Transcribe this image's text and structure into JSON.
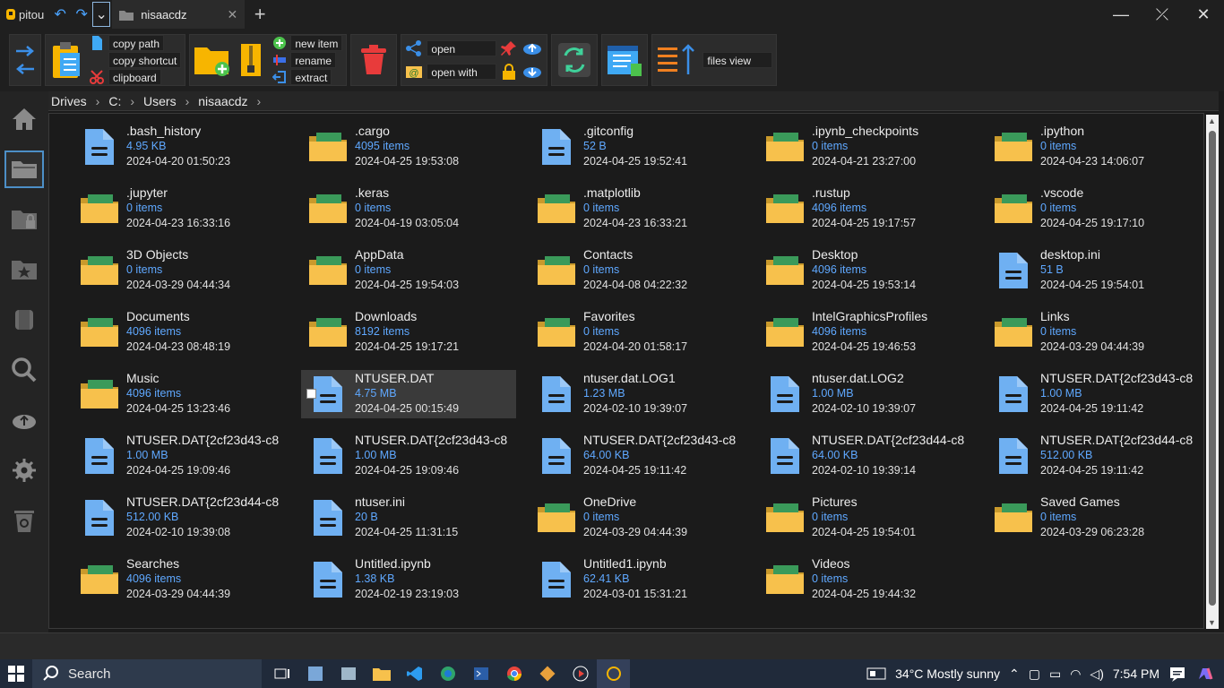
{
  "app": {
    "name": "pitou",
    "tab_title": "nisaacdz"
  },
  "toolbar": {
    "copy_path": "copy path",
    "copy_shortcut": "copy shortcut",
    "clipboard": "clipboard",
    "new_item": "new item",
    "rename": "rename",
    "extract": "extract",
    "open": "open",
    "open_with": "open with",
    "files_view": "files view"
  },
  "breadcrumb": [
    "Drives",
    "C:",
    "Users",
    "nisaacdz"
  ],
  "items": [
    {
      "name": ".bash_history",
      "size": "4.95 KB",
      "date": "2024-04-20 01:50:23",
      "type": "file"
    },
    {
      "name": ".cargo",
      "size": "4095 items",
      "date": "2024-04-25 19:53:08",
      "type": "folder"
    },
    {
      "name": ".gitconfig",
      "size": "52 B",
      "date": "2024-04-25 19:52:41",
      "type": "file"
    },
    {
      "name": ".ipynb_checkpoints",
      "size": "0 items",
      "date": "2024-04-21 23:27:00",
      "type": "folder"
    },
    {
      "name": ".ipython",
      "size": "0 items",
      "date": "2024-04-23 14:06:07",
      "type": "folder"
    },
    {
      "name": ".jupyter",
      "size": "0 items",
      "date": "2024-04-23 16:33:16",
      "type": "folder"
    },
    {
      "name": ".keras",
      "size": "0 items",
      "date": "2024-04-19 03:05:04",
      "type": "folder"
    },
    {
      "name": ".matplotlib",
      "size": "0 items",
      "date": "2024-04-23 16:33:21",
      "type": "folder"
    },
    {
      "name": ".rustup",
      "size": "4096 items",
      "date": "2024-04-25 19:17:57",
      "type": "folder"
    },
    {
      "name": ".vscode",
      "size": "0 items",
      "date": "2024-04-25 19:17:10",
      "type": "folder"
    },
    {
      "name": "3D Objects",
      "size": "0 items",
      "date": "2024-03-29 04:44:34",
      "type": "folder"
    },
    {
      "name": "AppData",
      "size": "0 items",
      "date": "2024-04-25 19:54:03",
      "type": "folder"
    },
    {
      "name": "Contacts",
      "size": "0 items",
      "date": "2024-04-08 04:22:32",
      "type": "folder"
    },
    {
      "name": "Desktop",
      "size": "4096 items",
      "date": "2024-04-25 19:53:14",
      "type": "folder"
    },
    {
      "name": "desktop.ini",
      "size": "51 B",
      "date": "2024-04-25 19:54:01",
      "type": "file"
    },
    {
      "name": "Documents",
      "size": "4096 items",
      "date": "2024-04-23 08:48:19",
      "type": "folder"
    },
    {
      "name": "Downloads",
      "size": "8192 items",
      "date": "2024-04-25 19:17:21",
      "type": "folder"
    },
    {
      "name": "Favorites",
      "size": "0 items",
      "date": "2024-04-20 01:58:17",
      "type": "folder"
    },
    {
      "name": "IntelGraphicsProfiles",
      "size": "4096 items",
      "date": "2024-04-25 19:46:53",
      "type": "folder"
    },
    {
      "name": "Links",
      "size": "0 items",
      "date": "2024-03-29 04:44:39",
      "type": "folder"
    },
    {
      "name": "Music",
      "size": "4096 items",
      "date": "2024-04-25 13:23:46",
      "type": "folder"
    },
    {
      "name": "NTUSER.DAT",
      "size": "4.75 MB",
      "date": "2024-04-25 00:15:49",
      "type": "file",
      "selected": true
    },
    {
      "name": "ntuser.dat.LOG1",
      "size": "1.23 MB",
      "date": "2024-02-10 19:39:07",
      "type": "file"
    },
    {
      "name": "ntuser.dat.LOG2",
      "size": "1.00 MB",
      "date": "2024-02-10 19:39:07",
      "type": "file"
    },
    {
      "name": "NTUSER.DAT{2cf23d43-c8",
      "size": "1.00 MB",
      "date": "2024-04-25 19:11:42",
      "type": "file"
    },
    {
      "name": "NTUSER.DAT{2cf23d43-c8",
      "size": "1.00 MB",
      "date": "2024-04-25 19:09:46",
      "type": "file"
    },
    {
      "name": "NTUSER.DAT{2cf23d43-c8",
      "size": "1.00 MB",
      "date": "2024-04-25 19:09:46",
      "type": "file"
    },
    {
      "name": "NTUSER.DAT{2cf23d43-c8",
      "size": "64.00 KB",
      "date": "2024-04-25 19:11:42",
      "type": "file"
    },
    {
      "name": "NTUSER.DAT{2cf23d44-c8",
      "size": "64.00 KB",
      "date": "2024-02-10 19:39:14",
      "type": "file"
    },
    {
      "name": "NTUSER.DAT{2cf23d44-c8",
      "size": "512.00 KB",
      "date": "2024-04-25 19:11:42",
      "type": "file"
    },
    {
      "name": "NTUSER.DAT{2cf23d44-c8",
      "size": "512.00 KB",
      "date": "2024-02-10 19:39:08",
      "type": "file"
    },
    {
      "name": "ntuser.ini",
      "size": "20 B",
      "date": "2024-04-25 11:31:15",
      "type": "file"
    },
    {
      "name": "OneDrive",
      "size": "0 items",
      "date": "2024-03-29 04:44:39",
      "type": "folder"
    },
    {
      "name": "Pictures",
      "size": "0 items",
      "date": "2024-04-25 19:54:01",
      "type": "folder"
    },
    {
      "name": "Saved Games",
      "size": "0 items",
      "date": "2024-03-29 06:23:28",
      "type": "folder"
    },
    {
      "name": "Searches",
      "size": "4096 items",
      "date": "2024-03-29 04:44:39",
      "type": "folder"
    },
    {
      "name": "Untitled.ipynb",
      "size": "1.38 KB",
      "date": "2024-02-19 23:19:03",
      "type": "file"
    },
    {
      "name": "Untitled1.ipynb",
      "size": "62.41 KB",
      "date": "2024-03-01 15:31:21",
      "type": "file"
    },
    {
      "name": "Videos",
      "size": "0 items",
      "date": "2024-04-25 19:44:32",
      "type": "folder"
    }
  ],
  "taskbar": {
    "search_label": "Search",
    "weather": "34°C  Mostly sunny",
    "time": "7:54 PM"
  },
  "colors": {
    "accent": "#4aa3ff",
    "folder": "#f7c14c",
    "file": "#6fb0f2"
  }
}
